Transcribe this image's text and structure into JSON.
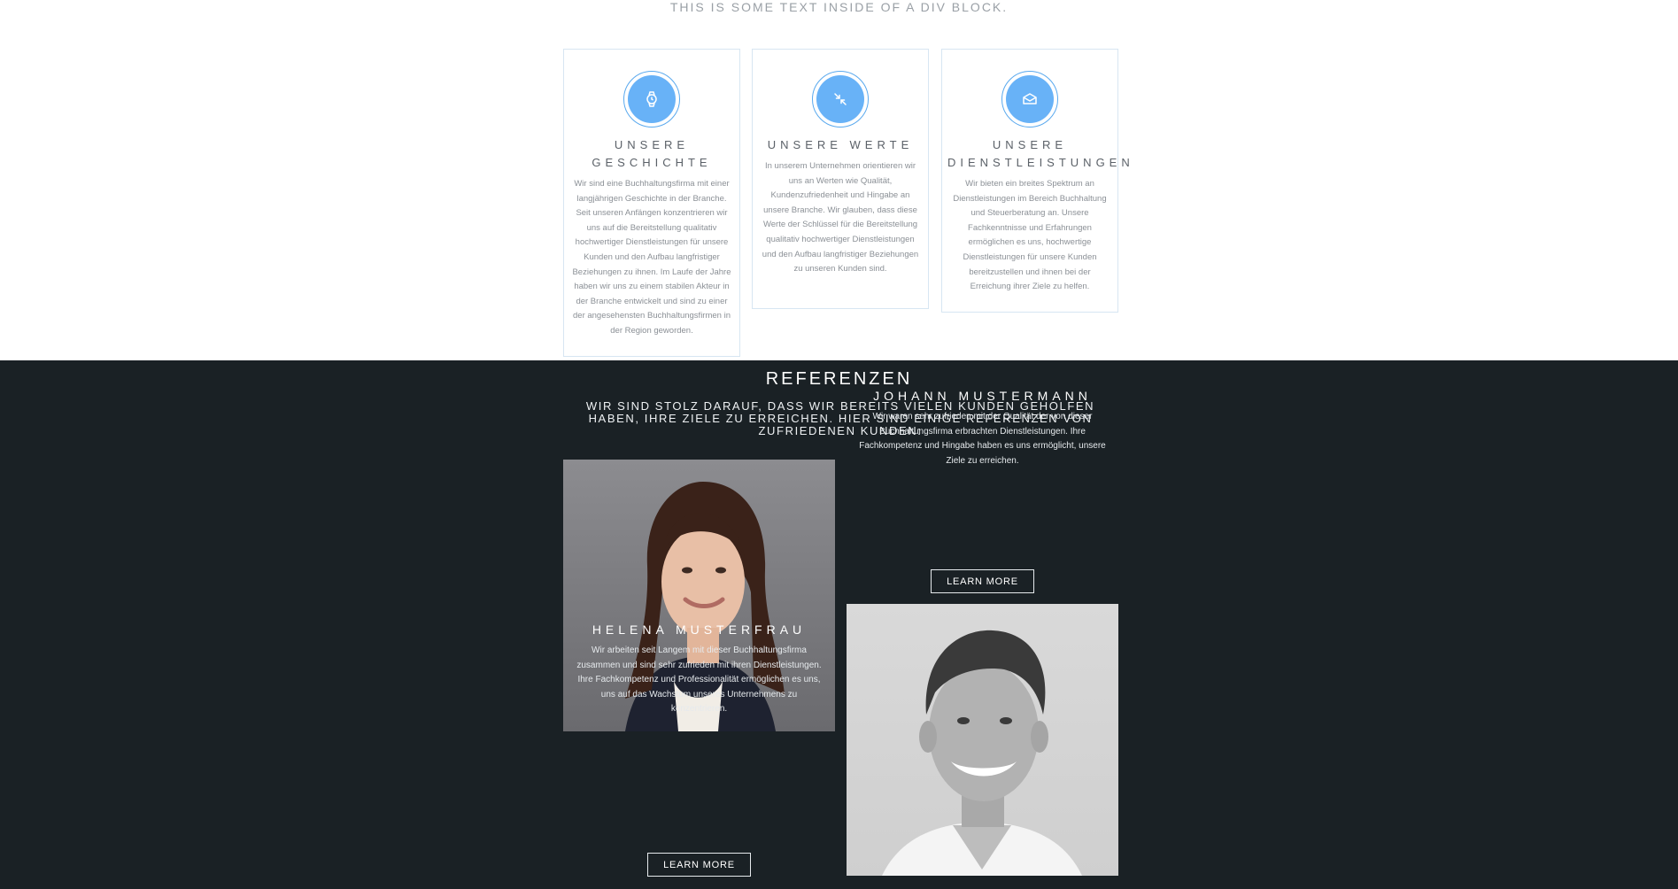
{
  "top": {
    "tagline": "THIS IS SOME TEXT INSIDE OF A DIV BLOCK."
  },
  "cards": [
    {
      "icon": "watch-icon",
      "title": "UNSERE GESCHICHTE",
      "text": "Wir sind eine Buchhaltungsfirma mit einer langjährigen Geschichte in der Branche. Seit unseren Anfängen konzentrieren wir uns auf die Bereitstellung qualitativ hochwertiger Dienstleistungen für unsere Kunden und den Aufbau langfristiger Beziehungen zu ihnen. Im Laufe der Jahre haben wir uns zu einem stabilen Akteur in der Branche entwickelt und sind zu einer der angesehensten Buchhaltungsfirmen in der Region geworden."
    },
    {
      "icon": "compress-arrows-icon",
      "title": "UNSERE WERTE",
      "text": "In unserem Unternehmen orientieren wir uns an Werten wie Qualität, Kundenzufriedenheit und Hingabe an unsere Branche. Wir glauben, dass diese Werte der Schlüssel für die Bereitstellung qualitativ hochwertiger Dienstleistungen und den Aufbau langfristiger Beziehungen zu unseren Kunden sind."
    },
    {
      "icon": "envelope-icon",
      "title": "UNSERE DIENSTLEISTUNGEN",
      "text": "Wir bieten ein breites Spektrum an Dienstleistungen im Bereich Buchhaltung und Steuerberatung an. Unsere Fachkenntnisse und Erfahrungen ermöglichen es uns, hochwertige Dienstleistungen für unsere Kunden bereitzustellen und ihnen bei der Erreichung ihrer Ziele zu helfen."
    }
  ],
  "references": {
    "title": "REFERENZEN",
    "subtitle": "WIR SIND STOLZ DARAUF, DASS WIR BEREITS VIELEN KUNDEN GEHOLFEN HABEN, IHRE ZIELE ZU ERREICHEN. HIER SIND EINIGE REFERENZEN VON ZUFRIEDENEN KUNDEN:",
    "items": [
      {
        "name": "HELENA MUSTERFRAU",
        "quote": "Wir arbeiten seit Langem mit dieser Buchhaltungsfirma zusammen und sind sehr zufrieden mit ihren Dienstleistungen. Ihre Fachkompetenz und Professionalität ermöglichen es uns, uns auf das Wachstum unseres Unternehmens zu konzentrieren.",
        "button": "LEARN MORE"
      },
      {
        "name": "JOHANN MUSTERMANN",
        "quote": "Wir waren sehr zufrieden mit der Qualität der von dieser Buchhaltungsfirma erbrachten Dienstleistungen. Ihre Fachkompetenz und Hingabe haben es uns ermöglicht, unsere Ziele zu erreichen.",
        "button": "LEARN MORE"
      }
    ]
  },
  "colors": {
    "accent": "#68b2f7",
    "dark_bg": "#1a2125",
    "card_border": "#d7e6f2"
  }
}
